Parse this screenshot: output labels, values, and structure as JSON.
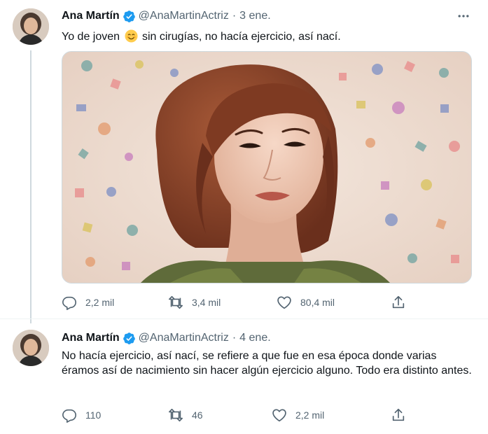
{
  "tweets": [
    {
      "name": "Ana Martín",
      "handle": "@AnaMartinActriz",
      "separator": "·",
      "time": "3 ene.",
      "text_before_emoji": "Yo de joven",
      "emoji": "smiling-face-icon",
      "text_after_emoji": "sin cirugías, no hacía ejercicio, así nací.",
      "replies": "2,2 mil",
      "retweets": "3,4 mil",
      "likes": "80,4 mil"
    },
    {
      "name": "Ana Martín",
      "handle": "@AnaMartinActriz",
      "separator": "·",
      "time": "4 ene.",
      "text": "No hacía ejercicio, así nací, se refiere a que fue en esa época donde varias éramos así de nacimiento sin hacer algún ejercicio alguno. Todo era distinto antes.",
      "replies": "110",
      "retweets": "46",
      "likes": "2,2 mil"
    }
  ],
  "colors": {
    "text": "#0f1419",
    "secondary": "#536471",
    "verified": "#1d9bf0",
    "thread_line": "#cfd9de"
  }
}
